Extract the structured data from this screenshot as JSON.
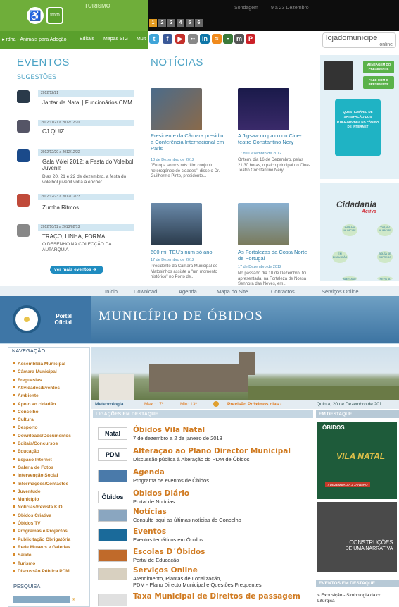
{
  "top": {
    "header": {
      "logo_text": "tmm",
      "site_name": "TURISMO",
      "pages": [
        "1",
        "2",
        "3",
        "4",
        "5",
        "6"
      ],
      "header_text_left": "Sondagem",
      "header_text_mid": "9 a 23 Dezembro"
    },
    "nav": {
      "items": [
        "rdha - Animais para Adoção",
        "Editais",
        "Mapas SIG",
        "Mult"
      ],
      "social_icons": [
        "twitter-icon",
        "facebook-icon",
        "youtube-icon",
        "flickr-icon",
        "linkedin-icon",
        "rss-icon",
        "delicious-icon",
        "myspace-icon",
        "pinterest-icon"
      ],
      "loja_logo": "lojadomunicipe",
      "loja_sub": "online"
    },
    "eventos": {
      "title": "EVENTOS",
      "subtitle": "SUGESTÕES",
      "items": [
        {
          "date": "2012/12/21",
          "title": "Jantar de Natal | Funcionários CMM",
          "desc": ""
        },
        {
          "date": "2012/11/27 a 2012/12/20",
          "title": "CJ QUIZ",
          "desc": ""
        },
        {
          "date": "2012/12/20 a 2012/12/22",
          "title": "Gala Vólei 2012: a Festa do Voleibol Juvenil!",
          "desc": "Dias 20, 21 e 22 de dezembro, a festa do voleibol juvenil volta a encher..."
        },
        {
          "date": "2012/12/23 a 2012/12/23",
          "title": "Zumba Ritmos",
          "desc": ""
        },
        {
          "date": "2012/10/11 a 2013/02/13",
          "title": "TRAÇO, LINHA, FORMA",
          "desc": "O DESENHO NA COLECÇÃO DA AUTARQUIA"
        }
      ],
      "more": "ver mais eventos"
    },
    "noticias": {
      "title": "NOTÍCIAS",
      "items": [
        {
          "title": "Presidente da Câmara presidiu a Conferência Internacional em Paris",
          "date": "18 de Dezembro de 2012",
          "desc": "\"Europa somos nós: Um conjunto heterogéneo de cidades\", disse o Dr. Guilherme Pinto, presidente..."
        },
        {
          "title": "A Jigsaw no palco do Cine-teatro Constantino Nery",
          "date": "17 de Dezembro de 2012",
          "desc": "Ontem, dia 16 de Dezembro, pelas 21.30 horas, o palco principal do Cine-Teatro Constantino Nery..."
        },
        {
          "title": "600 mil TEU's num só ano",
          "date": "17 de Dezembro de 2012",
          "desc": "Presidente da Câmara Municipal de Matosinhos assiste a \"um momento histórico\" no Porto de..."
        },
        {
          "title": "As Fortalezas da Costa Norte de Portugal",
          "date": "17 de Dezembro de 2012",
          "desc": "No passado dia 10 de Dezembro, foi apresentada, na Fortaleza de Nossa Senhora das Neves, em..."
        }
      ]
    },
    "right": {
      "btn1": "MENSAGEM DO PRESIDENTE",
      "btn2": "FALE COM O PRESIDENTE",
      "questionario": "QUESTIONÁRIO DE SATISFAÇÃO DOS UTILIZADORES DA PÁGINA DE INTERNET",
      "cidadania": "Cidadania",
      "activa": "Activa",
      "icons": [
        "LOJA DO MUNÍCIPE",
        "VOZ DO MUNÍCIPE",
        "EM DISCUSSÃO",
        "BOLSA DE EMPREGO",
        "ALERTA DE OBRAS",
        "REVISTA MUNICIPAL"
      ]
    }
  },
  "bottom": {
    "toplinks": [
      "Início",
      "Download",
      "Agenda",
      "Mapa do Site",
      "Contactos",
      "Serviços Online"
    ],
    "portal": "Portal Oficial",
    "title": "MUNICÍPIO DE ÓBIDOS",
    "nav_label": "NAVEGAÇÃO",
    "sidebar": [
      "Assembleia Municipal",
      "Câmara Municipal",
      "Freguesias",
      "Atividades/Eventos",
      "Ambiente",
      "Apoio ao cidadão",
      "Concelho",
      "Cultura",
      "Desporto",
      "Downloads/Documentos",
      "Editais/Concursos",
      "Educação",
      "Espaço Internet",
      "Galeria de Fotos",
      "Intervenção Social",
      "Informações/Contactos",
      "Juventude",
      "Município",
      "Notícias/Revista KIO",
      "Óbidos Criativa",
      "Óbidos TV",
      "Programas e Projectos",
      "Publicitação Obrigatória",
      "Rede Museus e Galerias",
      "Saúde",
      "Turismo",
      "Discussão Pública PDM"
    ],
    "pesquisa": "PESQUISA",
    "meteo": {
      "label": "Meteorologia",
      "max": "Max.: 17º",
      "min": "Min: 13º",
      "prev": "Previsão Próximos dias -",
      "date": "Quinta, 20 de Dezembro de 201"
    },
    "ligacoes_head": "LIGAÇÕES EM DESTAQUE",
    "destaque_head": "EM DESTAQUE",
    "eventos_head": "EVENTOS EM DESTAQUE",
    "eventos_item": "» Exposição - Simbologia da co Litúrgica",
    "links": [
      {
        "img": "Natal",
        "title": "Óbidos Vila Natal",
        "desc": "7 de dezembro a 2 de janeiro de 2013"
      },
      {
        "img": "PDM",
        "title": "Alteração ao Plano Director Municipal",
        "desc": "Discussão pública à Alteração do PDM de Óbidos"
      },
      {
        "img": "",
        "title": "Agenda",
        "desc": "Programa de eventos de Óbidos"
      },
      {
        "img": "Óbidos",
        "title": "Óbidos Diário",
        "desc": "Portal de Notícias"
      },
      {
        "img": "",
        "title": "Notícias",
        "desc": "Consulte aqui as últimas notícias do Concelho"
      },
      {
        "img": "",
        "title": "Eventos",
        "desc": "Eventos temáticos em Óbidos"
      },
      {
        "img": "",
        "title": "Escolas D´Óbidos",
        "desc": "Portal de Educação"
      },
      {
        "img": "",
        "title": "Serviços Online",
        "desc": "Atendimento, Plantas de Localização,",
        "desc2": "PDM - Plano Directo Municipal e Questões Frequentes"
      },
      {
        "img": "",
        "title": "Taxa Municipal de Direitos de passagem",
        "desc": ""
      }
    ],
    "dbox1_title": "ÓBIDOS",
    "dbox1_sub": "VILA NATAL",
    "dbox1_date": "7 DEZEMBRO A 2 JANEIRO",
    "dbox2_line1": "CONSTRUÇÕES",
    "dbox2_line2": "DE UMA NARRATIVA",
    "colors": {
      "accent": "#d07a20",
      "blue": "#3d74a2",
      "green": "#5aa02c"
    }
  }
}
